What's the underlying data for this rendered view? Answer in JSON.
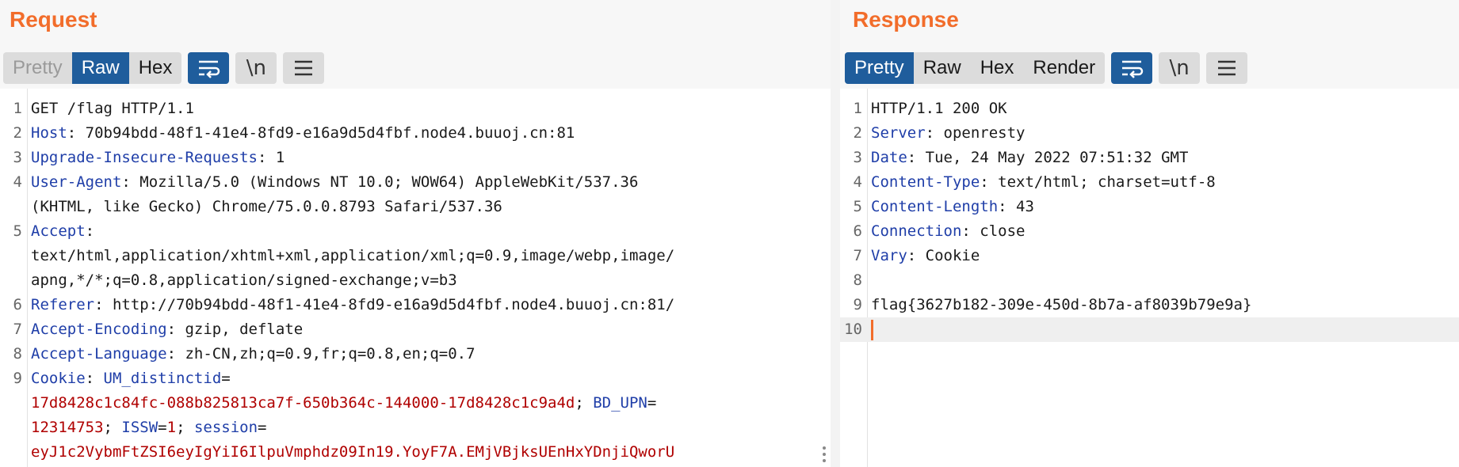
{
  "request": {
    "title": "Request",
    "tabs": [
      "Pretty",
      "Raw",
      "Hex"
    ],
    "lines": [
      {
        "no": "1",
        "text": "GET /flag HTTP/1.1"
      },
      {
        "no": "2",
        "name": "Host",
        "value": " 70b94bdd-48f1-41e4-8fd9-e16a9d5d4fbf.node4.buuoj.cn:81"
      },
      {
        "no": "3",
        "name": "Upgrade-Insecure-Requests",
        "value": " 1"
      },
      {
        "no": "4",
        "name": "User-Agent",
        "value": " Mozilla/5.0 (Windows NT 10.0; WOW64) AppleWebKit/537.36"
      },
      {
        "no": "",
        "text": "(KHTML, like Gecko) Chrome/75.0.0.8793 Safari/537.36"
      },
      {
        "no": "5",
        "name": "Accept",
        "value": ""
      },
      {
        "no": "",
        "text": "text/html,application/xhtml+xml,application/xml;q=0.9,image/webp,image/"
      },
      {
        "no": "",
        "text": "apng,*/*;q=0.8,application/signed-exchange;v=b3"
      },
      {
        "no": "6",
        "name": "Referer",
        "value": " http://70b94bdd-48f1-41e4-8fd9-e16a9d5d4fbf.node4.buuoj.cn:81/"
      },
      {
        "no": "7",
        "name": "Accept-Encoding",
        "value": " gzip, deflate"
      },
      {
        "no": "8",
        "name": "Accept-Language",
        "value": " zh-CN,zh;q=0.9,fr;q=0.8,en;q=0.7"
      },
      {
        "no": "9",
        "name": "Cookie",
        "value": " "
      },
      {
        "no": "",
        "text": ""
      },
      {
        "no": "",
        "text": ""
      },
      {
        "no": "",
        "text": ""
      }
    ],
    "cookie": {
      "name1": "UM_distinctid",
      "val1": "17d8428c1c84fc-088b825813ca7f-650b364c-144000-17d8428c1c9a4d",
      "name2": "BD_UPN",
      "val2": "12314753",
      "name3": "ISSW",
      "val3": "1",
      "name4": "session",
      "val4": "eyJ1c2VybmFtZSI6eyIgYiI6IlpuVmphdz09In19.YoyF7A.EMjVBjksUEnHxYDnjiQworU"
    }
  },
  "response": {
    "title": "Response",
    "tabs": [
      "Pretty",
      "Raw",
      "Hex",
      "Render"
    ],
    "lines": [
      {
        "no": "1",
        "text": "HTTP/1.1 200 OK"
      },
      {
        "no": "2",
        "name": "Server",
        "value": " openresty"
      },
      {
        "no": "3",
        "name": "Date",
        "value": " Tue, 24 May 2022 07:51:32 GMT"
      },
      {
        "no": "4",
        "name": "Content-Type",
        "value": " text/html; charset=utf-8"
      },
      {
        "no": "5",
        "name": "Content-Length",
        "value": " 43"
      },
      {
        "no": "6",
        "name": "Connection",
        "value": " close"
      },
      {
        "no": "7",
        "name": "Vary",
        "value": " Cookie"
      },
      {
        "no": "8",
        "text": ""
      },
      {
        "no": "9",
        "text": "flag{3627b182-309e-450d-8b7a-af8039b79e9a}"
      },
      {
        "no": "10",
        "text": ""
      }
    ]
  },
  "icons": {
    "wrap": "⮌",
    "newline": "\\n",
    "menu": "☰"
  },
  "colors": {
    "accent": "#f26d2b",
    "active_tab": "#1f5d9c",
    "header_name": "#1f3ea8",
    "cookie_value": "#b00000"
  }
}
